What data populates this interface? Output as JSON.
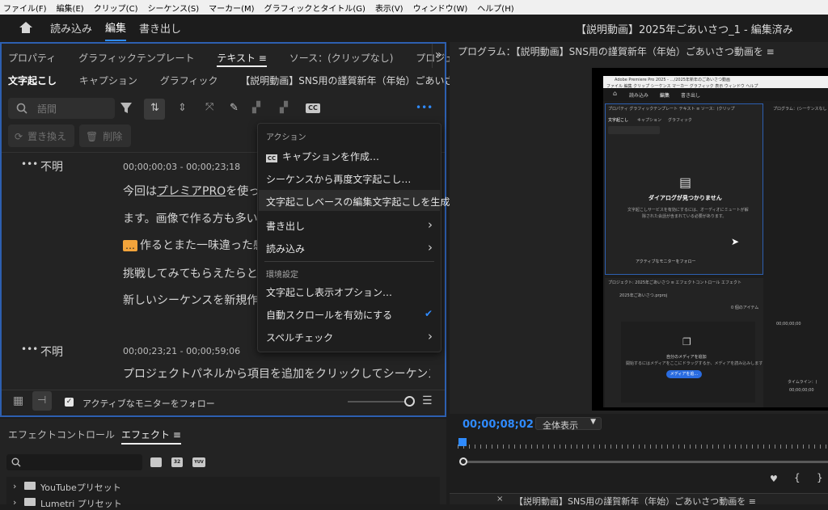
{
  "menubar": {
    "items": [
      "ファイル(F)",
      "編集(E)",
      "クリップ(C)",
      "シーケンス(S)",
      "マーカー(M)",
      "グラフィックとタイトル(G)",
      "表示(V)",
      "ウィンドウ(W)",
      "ヘルプ(H)"
    ]
  },
  "header": {
    "nav": [
      "読み込み",
      "編集",
      "書き出し"
    ],
    "title": "【説明動画】2025年ごあいさつ_1 - 編集済み"
  },
  "text_panel": {
    "tabs": [
      "プロパティ",
      "グラフィックテンプレート",
      "テキスト ≡",
      "ソース：(クリップなし)",
      "プロジェクト:"
    ],
    "subtabs": [
      "文字起こし",
      "キャプション",
      "グラフィック",
      "【説明動画】SNS用の謹賀新年（年始）ごあいさつ動画を作る"
    ],
    "search_placeholder": "語間",
    "replace_label": "置き換え",
    "delete_label": "削除",
    "cc_label": "CC",
    "more_label": "•••",
    "speaker1": "不明",
    "speaker1_tc": "00;00;00;03 - 00;00;23;18",
    "speaker2": "不明",
    "speaker2_tc": "00;00;23;21 - 00;00;59;06",
    "line1a": "今回は",
    "line1b": "プレミアPRO",
    "line1c": "を使って",
    "line2": "ます。画像で作る方も多い",
    "line3a": "…",
    "line3b": "作るとまた一味違った感",
    "line4": "挑戦してみてもらえたらと思",
    "line5": "新しいシーケンスを新規作成",
    "line6": "プロジェクトパネルから項目を追加をクリックしてシーケンス図",
    "follow_label": "アクティブなモニターをフォロー"
  },
  "context_menu": {
    "head1": "アクション",
    "create_caption": "キャプションを作成…",
    "retranscribe": "シーケンスから再度文字起こし…",
    "generate": "文字起こしベースの編集文字起こしを生成…",
    "export": "書き出し",
    "import": "読み込み",
    "head2": "環境設定",
    "display_options": "文字起こし表示オプション…",
    "autoscroll": "自動スクロールを有効にする",
    "spellcheck": "スペルチェック",
    "check": "✔",
    "chevron": "›"
  },
  "effects_panel": {
    "tabs": [
      "エフェクトコントロール",
      "エフェクト ≡"
    ],
    "item1": "YouTubeプリセット",
    "item2": "Lumetri プリセット",
    "b1": "32",
    "b2": "YUV"
  },
  "program": {
    "title": "プログラム：【説明動画】SNS用の謹賀新年（年始）ごあいさつ動画を ≡",
    "timecode": "00;00;08;02",
    "fit": "全体表示",
    "bottom_title": "【説明動画】SNS用の謹賀新年（年始）ごあいさつ動画を ≡"
  },
  "nested": {
    "app_title": "Adobe Premiere Pro 2025 - …/2025年新年のごあいさつ動画",
    "menu": "ファイル  編集  クリップ  シーケンス  マーカー  グラフィック  表示  ウィンドウ  ヘルプ",
    "nav": [
      "読み込み",
      "編集",
      "書き出し"
    ],
    "tabs": "プロパティ  グラフィックテンプレート  テキスト ≡  ソース：(クリップ",
    "prog": "プログラム：(シーケンスなし",
    "subtabs": [
      "文字起こし",
      "キャプション",
      "グラフィック"
    ],
    "dialog": "ダイアログが見つかりません",
    "dialog_sub1": "文字起こしサービスを有効にするには、オーディオにミュートが解",
    "dialog_sub2": "除された会話が含まれている必要があります。",
    "follow": "アクティブなモニターをフォロー",
    "project_tabs": "プロジェクト: 2025年ごあいさつ ≡   エフェクトコントロール   エフェクト",
    "project_file": "2025年ごあいさつ.prproj",
    "items": "0 個のアイテム",
    "tc": "00;00;00;00",
    "media_title": "自分のメディアを追加",
    "media_sub": "開始するにはメディアをここにドラッグするか、メディアを読み込みします",
    "media_btn": "メディアを追...",
    "timeline": "タイムライン：(",
    "tc2": "00;00;00;00"
  }
}
